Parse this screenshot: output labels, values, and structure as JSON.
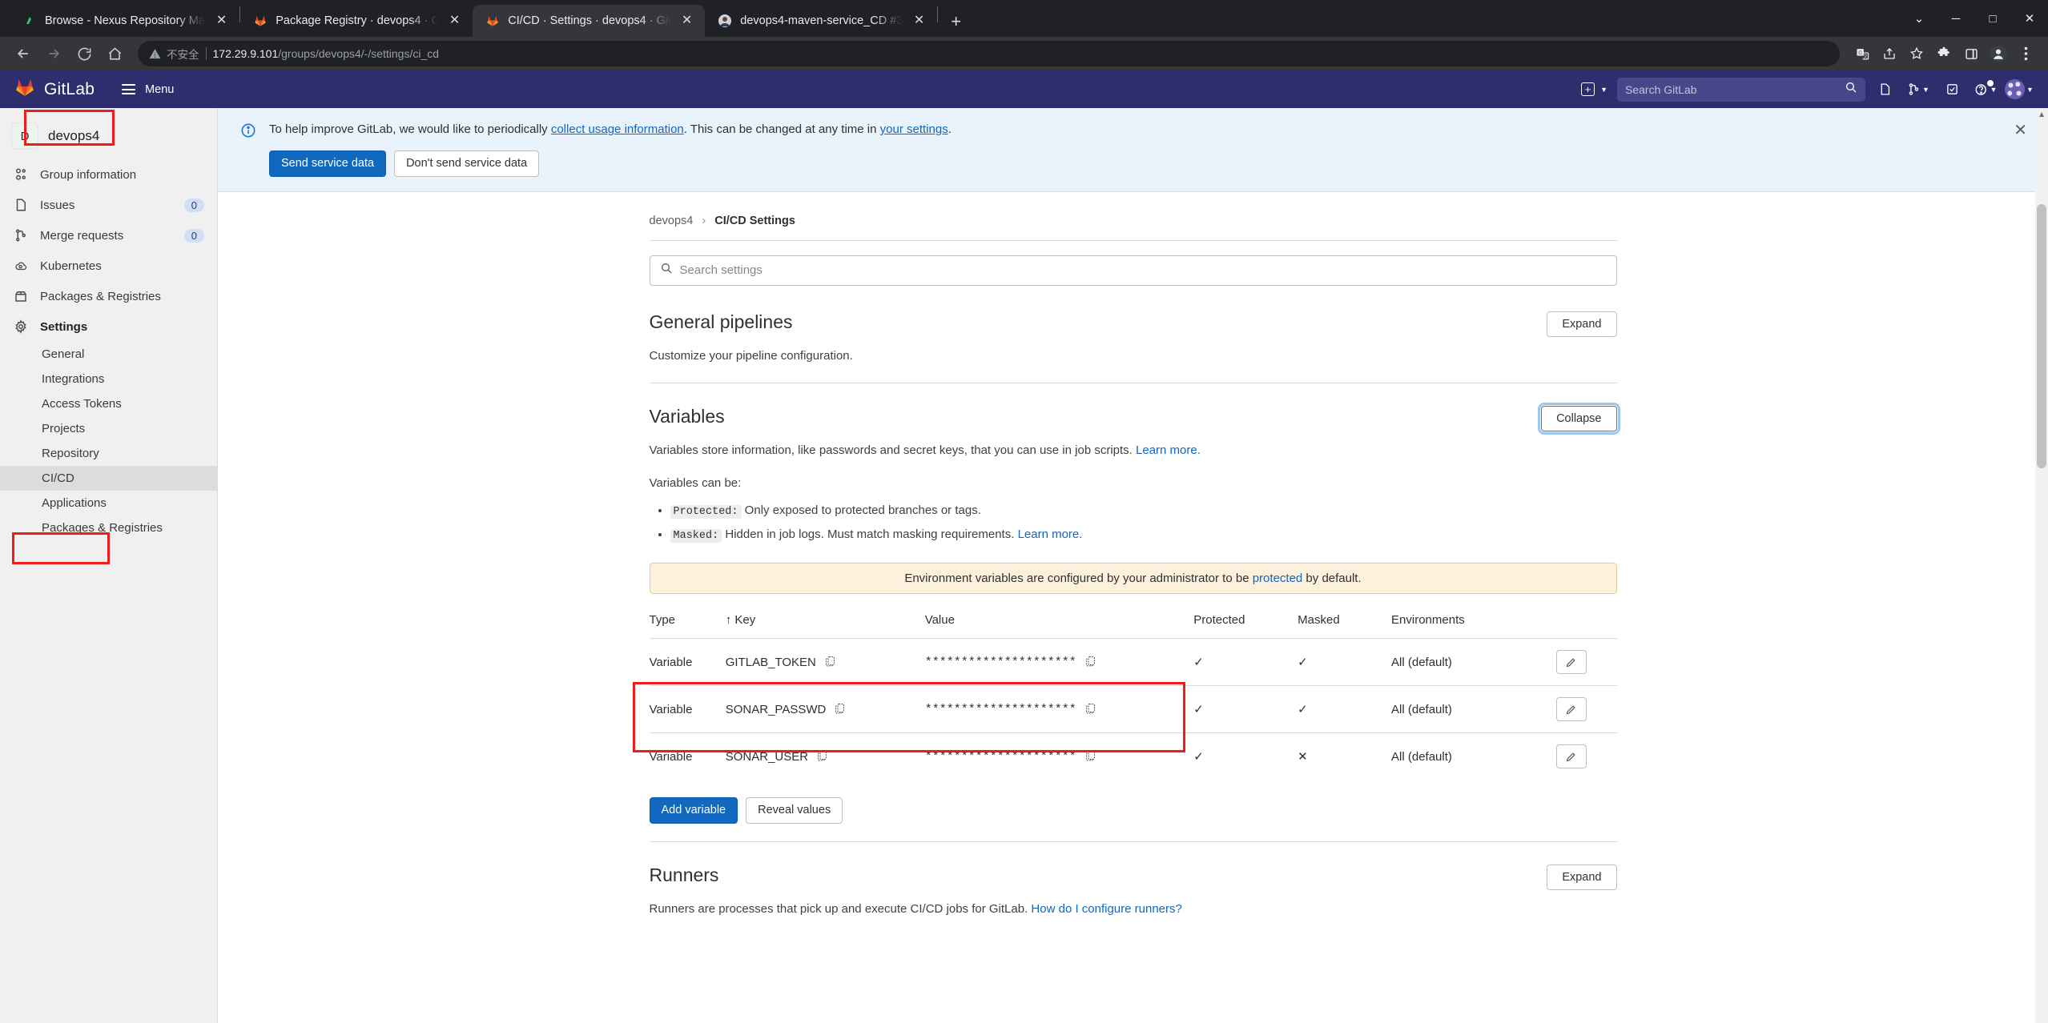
{
  "browser": {
    "tabs": [
      {
        "title": "Browse - Nexus Repository Ma",
        "favicon": "nexus-icon",
        "active": false
      },
      {
        "title": "Package Registry · devops4 · G",
        "favicon": "gitlab-icon",
        "active": false
      },
      {
        "title": "CI/CD · Settings · devops4 · Git",
        "favicon": "gitlab-icon",
        "active": true
      },
      {
        "title": "devops4-maven-service_CD #3",
        "favicon": "user-avatar-icon",
        "active": false
      }
    ],
    "new_tab_label": "+",
    "window_controls": {
      "minimize": "─",
      "maximize": "□",
      "close": "✕",
      "more": "⌄"
    },
    "address": {
      "security_label": "不安全",
      "host": "172.29.9.101",
      "path": "/groups/devops4/-/settings/ci_cd"
    },
    "toolbar_icons": [
      "translate-icon",
      "share-icon",
      "bookmark-star-icon",
      "extensions-puzzle-icon",
      "side-panel-icon",
      "profile-icon",
      "more-vertical-icon"
    ]
  },
  "gitlab_header": {
    "brand": "GitLab",
    "menu_label": "Menu",
    "search_placeholder": "Search GitLab",
    "search_value": "",
    "icons": [
      "plus-square-icon",
      "issues-icon",
      "merge-requests-icon",
      "todos-icon",
      "help-icon",
      "user-avatar-icon"
    ]
  },
  "sidebar": {
    "context": {
      "avatar_letter": "D",
      "name": "devops4"
    },
    "items": [
      {
        "label": "Group information",
        "icon": "group-icon",
        "badge": null
      },
      {
        "label": "Issues",
        "icon": "issues-icon",
        "badge": "0"
      },
      {
        "label": "Merge requests",
        "icon": "merge-requests-icon",
        "badge": "0"
      },
      {
        "label": "Kubernetes",
        "icon": "kubernetes-icon",
        "badge": null
      },
      {
        "label": "Packages & Registries",
        "icon": "package-icon",
        "badge": null
      },
      {
        "label": "Settings",
        "icon": "gear-icon",
        "badge": null,
        "strong": true
      }
    ],
    "sub_items": [
      {
        "label": "General",
        "active": false
      },
      {
        "label": "Integrations",
        "active": false
      },
      {
        "label": "Access Tokens",
        "active": false
      },
      {
        "label": "Projects",
        "active": false
      },
      {
        "label": "Repository",
        "active": false
      },
      {
        "label": "CI/CD",
        "active": true
      },
      {
        "label": "Applications",
        "active": false
      },
      {
        "label": "Packages & Registries",
        "active": false
      }
    ]
  },
  "banner": {
    "text_before": "To help improve GitLab, we would like to periodically ",
    "link1": "collect usage information",
    "text_middle": ". This can be changed at any time in ",
    "link2": "your settings",
    "text_after": ".",
    "primary_button": "Send service data",
    "secondary_button": "Don't send service data",
    "close_label": "✕"
  },
  "breadcrumb": {
    "root": "devops4",
    "separator": "›",
    "current": "CI/CD Settings"
  },
  "search_settings": {
    "placeholder": "Search settings",
    "value": ""
  },
  "sections": {
    "general_pipelines": {
      "title": "General pipelines",
      "description": "Customize your pipeline configuration.",
      "toggle_label": "Expand"
    },
    "variables": {
      "title": "Variables",
      "toggle_label": "Collapse",
      "desc_text": "Variables store information, like passwords and secret keys, that you can use in job scripts. ",
      "desc_link": "Learn more.",
      "can_be_label": "Variables can be:",
      "bullets": [
        {
          "code": "Protected:",
          "text": " Only exposed to protected branches or tags.",
          "link": null
        },
        {
          "code": "Masked:",
          "text": " Hidden in job logs. Must match masking requirements. ",
          "link": "Learn more."
        }
      ],
      "alert": {
        "before": "Environment variables are configured by your administrator to be ",
        "link": "protected",
        "after": " by default."
      },
      "table": {
        "headers": [
          "Type",
          "↑ Key",
          "Value",
          "Protected",
          "Masked",
          "Environments",
          ""
        ],
        "rows": [
          {
            "type": "Variable",
            "key": "GITLAB_TOKEN",
            "value": "*********************",
            "protected": "✓",
            "masked": "✓",
            "environments": "All (default)",
            "action": "edit-icon"
          },
          {
            "type": "Variable",
            "key": "SONAR_PASSWD",
            "value": "*********************",
            "protected": "✓",
            "masked": "✓",
            "environments": "All (default)",
            "action": "edit-icon"
          },
          {
            "type": "Variable",
            "key": "SONAR_USER",
            "value": "*********************",
            "protected": "✓",
            "masked": "✕",
            "environments": "All (default)",
            "action": "edit-icon"
          }
        ]
      },
      "add_variable_button": "Add variable",
      "reveal_values_button": "Reveal values"
    },
    "runners": {
      "title": "Runners",
      "description_text": "Runners are processes that pick up and execute CI/CD jobs for GitLab. ",
      "description_link": "How do I configure runners?",
      "toggle_label": "Expand"
    }
  },
  "colors": {
    "gitlab_purple": "#2e2e6f",
    "primary_blue": "#1068bf",
    "link_blue": "#1068bf",
    "annotation_red": "#ee1c1c",
    "warn_bg": "#fdf1dd",
    "banner_bg": "#e9f3fc"
  }
}
